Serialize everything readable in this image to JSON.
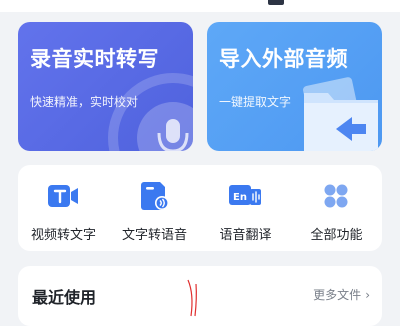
{
  "cards": {
    "record": {
      "title": "录音实时转写",
      "subtitle": "快速精准，实时校对"
    },
    "import": {
      "title": "导入外部音频",
      "subtitle": "一键提取文字"
    }
  },
  "features": [
    {
      "label": "视频转文字",
      "icon": "video-text-icon"
    },
    {
      "label": "文字转语音",
      "icon": "text-speech-icon"
    },
    {
      "label": "语音翻译",
      "icon": "translate-icon",
      "badge": "En"
    },
    {
      "label": "全部功能",
      "icon": "grid-icon"
    }
  ],
  "recent": {
    "title": "最近使用",
    "more": "更多文件",
    "more_chevron": "›"
  },
  "colors": {
    "record_card": "#5868e6",
    "import_card": "#55a0f4",
    "accent": "#4d86f1",
    "background": "#f1f3f6"
  }
}
